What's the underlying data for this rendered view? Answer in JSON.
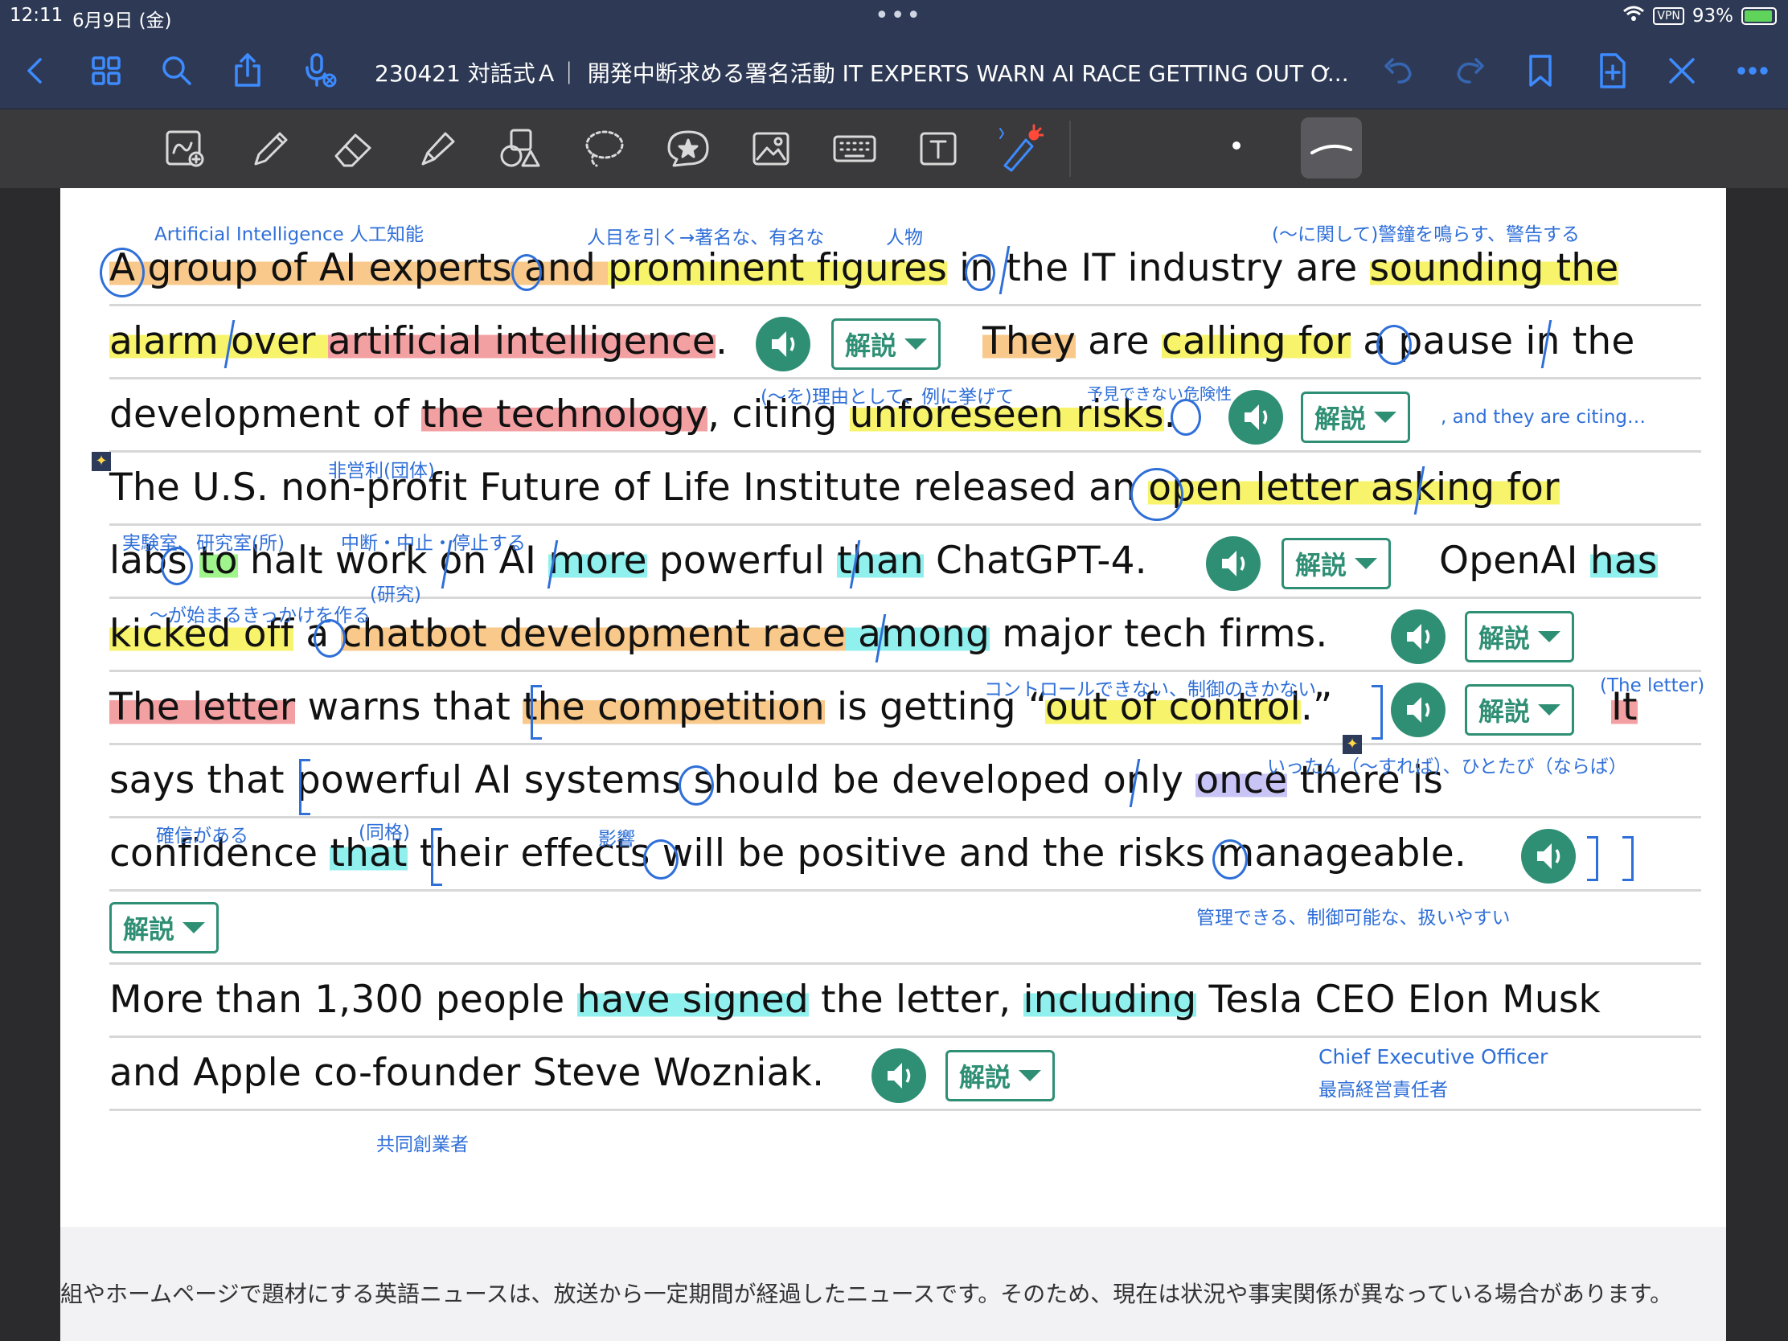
{
  "status": {
    "time": "12:11",
    "date": "6月9日 (金)",
    "vpn": "VPN",
    "battery": "93%"
  },
  "document": {
    "title": "230421 対話式Ａ｜ 開発中断求める署名活動 IT EXPERTS WARN AI RACE GETTING OUT O..."
  },
  "toolbar_icons": [
    "back-icon",
    "grid-icon",
    "search-icon",
    "share-icon",
    "mic-icon",
    "undo-icon",
    "redo-icon",
    "bookmark-icon",
    "add-page-icon",
    "close-icon",
    "more-icon"
  ],
  "tools": [
    "zoom-lasso-icon",
    "pen-icon",
    "eraser-icon",
    "highlighter-icon",
    "shapes-icon",
    "lasso-icon",
    "sticker-icon",
    "image-icon",
    "keyboard-icon",
    "text-icon",
    "laser-pointer-icon"
  ],
  "kaisetsu_label": "解説",
  "lines": {
    "l1": {
      "a": "A group of AI experts and ",
      "b": "prominent figures",
      "c": " in the IT industry are ",
      "d": "sounding the"
    },
    "l2": {
      "a": "alarm over ",
      "b": "artificial intelligence",
      "c": ".",
      "d": "They",
      "e": " are ",
      "f": "calling for",
      "g": " a pause in the"
    },
    "l3": {
      "a": "development of ",
      "b": "the technology",
      "c": ", citing ",
      "d": "unforeseen risks",
      "e": "."
    },
    "l4": {
      "a": "The U.S. non-profit Future of Life Institute released an ",
      "b": "open letter asking for"
    },
    "l5": {
      "a": "labs ",
      "b": "to",
      "c": " halt work on AI ",
      "d": "more",
      "e": " powerful ",
      "f": "than",
      "g": " ChatGPT-4.",
      "h": "OpenAI ",
      "i": "has"
    },
    "l6": {
      "a": "kicked off",
      "b": " a ",
      "c": "chatbot development race",
      "d": " among",
      "e": " major tech firms."
    },
    "l7": {
      "a": "The letter",
      "b": " warns that ",
      "c": "the competition",
      "d": " is getting “",
      "e": "out of control",
      "f": ".”",
      "g": "It"
    },
    "l8": {
      "a": "says that powerful AI systems should be developed only ",
      "b": "once",
      "c": " there is"
    },
    "l9": {
      "a": "confidence ",
      "b": "that",
      "c": " their effects will be positive and the risks manageable."
    },
    "l10": {
      "a": "More than 1,300 people ",
      "b": "have signed",
      "c": " the letter, ",
      "d": "including",
      "e": " Tesla CEO Elon Musk"
    },
    "l11": {
      "a": "and Apple co-founder Steve Wozniak."
    }
  },
  "annotations": {
    "a1": "Artificial Intelligence 人工知能",
    "a2": "人目を引く→著名な、有名な",
    "a3": "人物",
    "a4": "(〜に関して)警鐘を鳴らす、警告する",
    "a5": "(〜を)理由として、例に挙げて",
    "a6": "予見できない危険性",
    "a7": ", and they are citing…",
    "a8": "非営利(団体)",
    "a9": "実験室、研究室(所)",
    "a10": "中断・中止・停止する",
    "a11": "(研究)",
    "a12": "〜が始まるきっかけを作る",
    "a13": "コントロールできない、制御のきかない",
    "a14": "(The letter)",
    "a15": "いったん（〜すれば）、ひとたび（ならば）",
    "a16": "確信がある",
    "a17": "(同格)",
    "a18": "影響",
    "a19": "管理できる、制御可能な、扱いやすい",
    "a20": "Chief Executive Officer",
    "a21": "最高経営責任者",
    "a22": "共同創業者"
  },
  "footer": "組やホームページで題材にする英語ニュースは、放送から一定期間が経過したニュースです。そのため、現在は状況や事実関係が異なっている場合があります。",
  "colors": {
    "bar": "#2e3a55",
    "accent": "#3d8bff",
    "teal": "#2f8f74",
    "ink": "#2f6fd8"
  }
}
